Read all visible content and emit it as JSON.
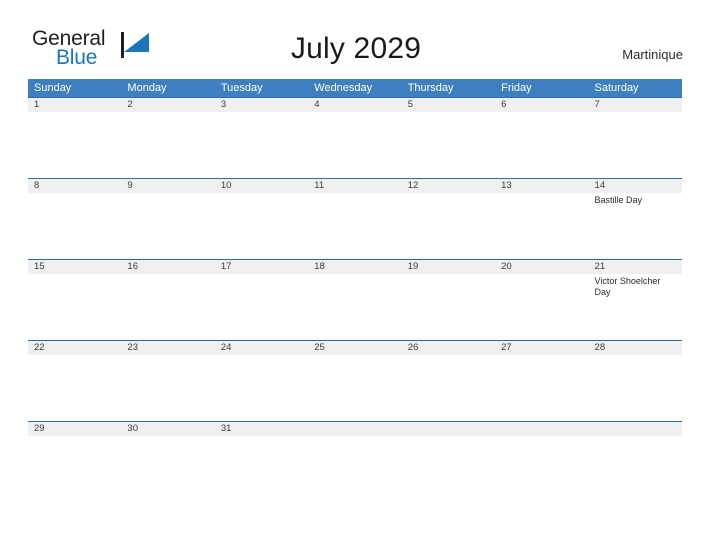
{
  "logo": {
    "word_one": "General",
    "word_two": "Blue",
    "icon": "flag-icon"
  },
  "header": {
    "title": "July 2029",
    "region": "Martinique"
  },
  "colors": {
    "header_blue": "#3d7fbf",
    "rule_blue": "#2e6da4",
    "day_band_gray": "#f0f0f0",
    "logo_blue": "#1b75bb",
    "logo_dark": "#231f20"
  },
  "calendar": {
    "day_headers": [
      "Sunday",
      "Monday",
      "Tuesday",
      "Wednesday",
      "Thursday",
      "Friday",
      "Saturday"
    ],
    "weeks": [
      [
        {
          "day": "1",
          "events": []
        },
        {
          "day": "2",
          "events": []
        },
        {
          "day": "3",
          "events": []
        },
        {
          "day": "4",
          "events": []
        },
        {
          "day": "5",
          "events": []
        },
        {
          "day": "6",
          "events": []
        },
        {
          "day": "7",
          "events": []
        }
      ],
      [
        {
          "day": "8",
          "events": []
        },
        {
          "day": "9",
          "events": []
        },
        {
          "day": "10",
          "events": []
        },
        {
          "day": "11",
          "events": []
        },
        {
          "day": "12",
          "events": []
        },
        {
          "day": "13",
          "events": []
        },
        {
          "day": "14",
          "events": [
            "Bastille Day"
          ]
        }
      ],
      [
        {
          "day": "15",
          "events": []
        },
        {
          "day": "16",
          "events": []
        },
        {
          "day": "17",
          "events": []
        },
        {
          "day": "18",
          "events": []
        },
        {
          "day": "19",
          "events": []
        },
        {
          "day": "20",
          "events": []
        },
        {
          "day": "21",
          "events": [
            "Victor Shoelcher Day"
          ]
        }
      ],
      [
        {
          "day": "22",
          "events": []
        },
        {
          "day": "23",
          "events": []
        },
        {
          "day": "24",
          "events": []
        },
        {
          "day": "25",
          "events": []
        },
        {
          "day": "26",
          "events": []
        },
        {
          "day": "27",
          "events": []
        },
        {
          "day": "28",
          "events": []
        }
      ],
      [
        {
          "day": "29",
          "events": []
        },
        {
          "day": "30",
          "events": []
        },
        {
          "day": "31",
          "events": []
        },
        {
          "day": "",
          "events": []
        },
        {
          "day": "",
          "events": []
        },
        {
          "day": "",
          "events": []
        },
        {
          "day": "",
          "events": []
        }
      ]
    ]
  }
}
